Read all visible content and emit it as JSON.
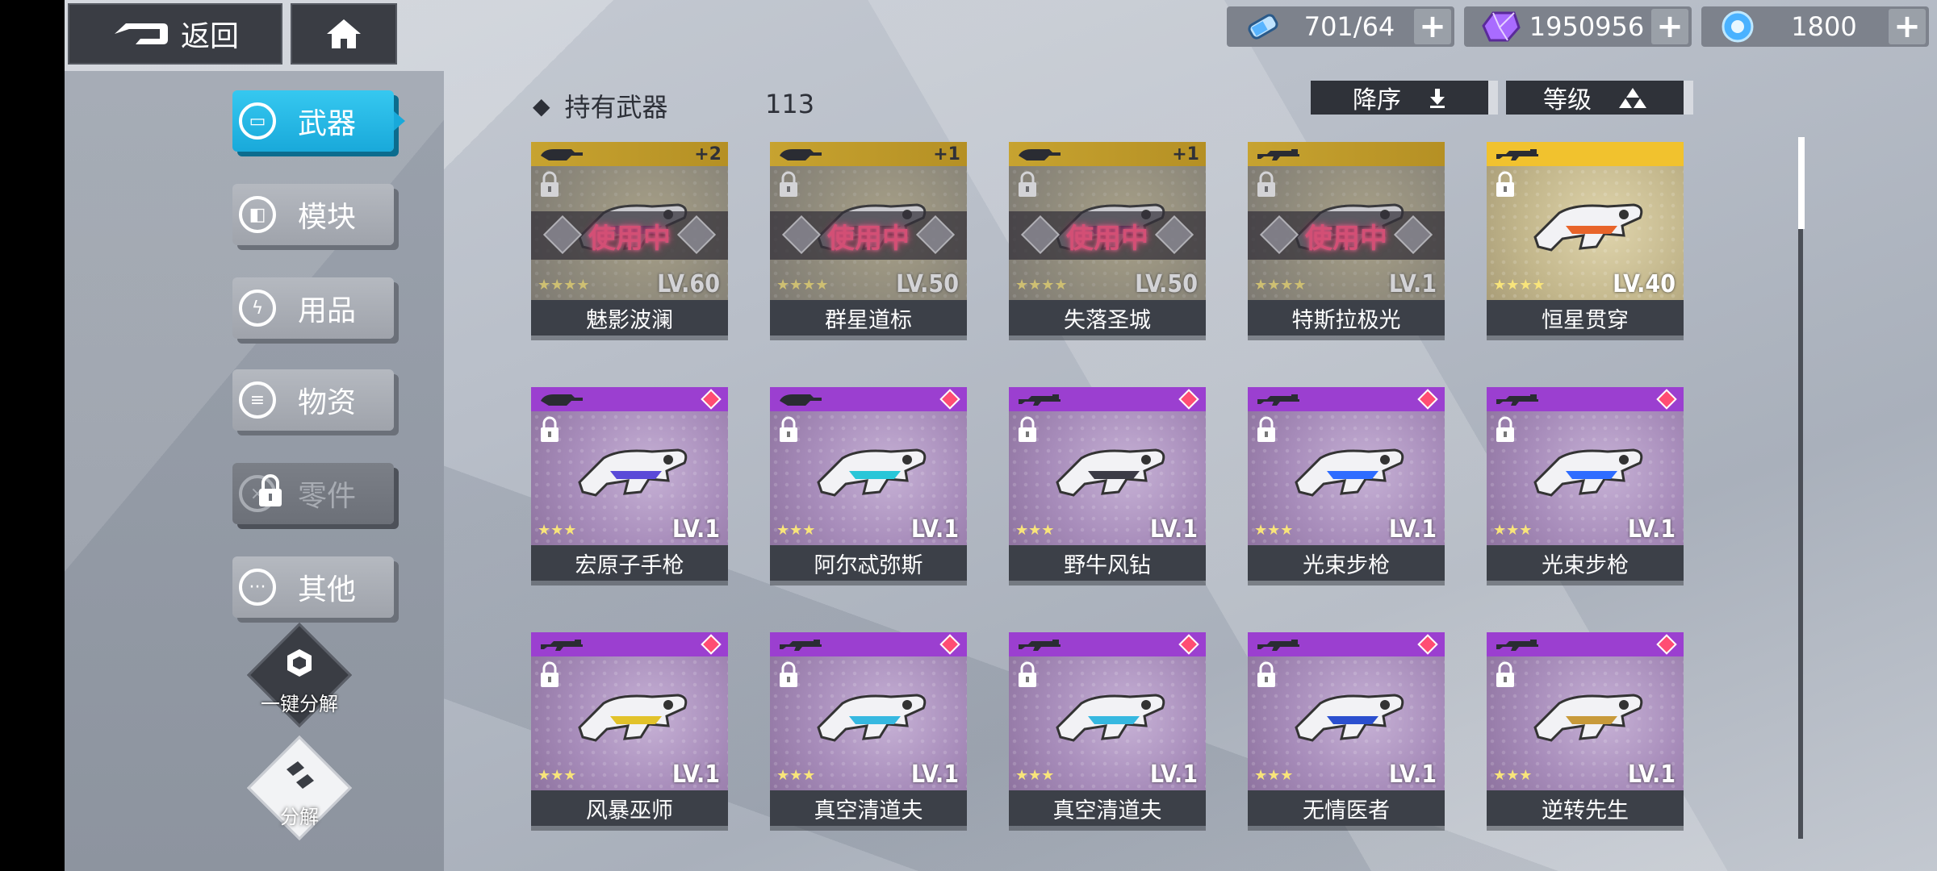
{
  "topbar": {
    "back_label": "返回",
    "resources": [
      {
        "icon": "energy-vial-icon",
        "value": "701/64"
      },
      {
        "icon": "purple-crystal-icon",
        "value": "1950956"
      },
      {
        "icon": "blue-orb-icon",
        "value": "1800"
      }
    ]
  },
  "sidebar": {
    "categories": [
      {
        "label": "武器",
        "icon": "gun-icon",
        "state": "active"
      },
      {
        "label": "模块",
        "icon": "module-icon",
        "state": "normal"
      },
      {
        "label": "用品",
        "icon": "lightning-icon",
        "state": "normal"
      },
      {
        "label": "物资",
        "icon": "supplies-icon",
        "state": "normal"
      },
      {
        "label": "零件",
        "icon": "parts-icon",
        "state": "locked"
      },
      {
        "label": "其他",
        "icon": "more-icon",
        "state": "normal"
      }
    ],
    "quick_dismantle_label": "一键分解",
    "dismantle_label": "分解"
  },
  "list": {
    "title": "持有武器",
    "count": "113",
    "sort_order_label": "降序",
    "sort_key_label": "等级"
  },
  "colors": {
    "accent": "#19a9da",
    "gold": "#f1c22e",
    "purple": "#9b3fd0",
    "in_use": "#ff4f7e"
  },
  "weapons": [
    {
      "name": "魅影波澜",
      "level": "LV.60",
      "stars": 4,
      "rarity": "gold",
      "plus": "+2",
      "in_use": true,
      "in_use_label": "使用中",
      "icon": "heavy-gun-icon"
    },
    {
      "name": "群星道标",
      "level": "LV.50",
      "stars": 4,
      "rarity": "gold",
      "plus": "+1",
      "in_use": true,
      "in_use_label": "使用中",
      "icon": "heavy-gun-icon"
    },
    {
      "name": "失落圣城",
      "level": "LV.50",
      "stars": 4,
      "rarity": "gold",
      "plus": "+1",
      "in_use": true,
      "in_use_label": "使用中",
      "icon": "heavy-gun-icon"
    },
    {
      "name": "特斯拉极光",
      "level": "LV.1",
      "stars": 4,
      "rarity": "gold",
      "plus": "",
      "in_use": true,
      "in_use_label": "使用中",
      "icon": "rifle-icon"
    },
    {
      "name": "恒星贯穿",
      "level": "LV.40",
      "stars": 4,
      "rarity": "gold-bright",
      "plus": "",
      "in_use": false,
      "icon": "rifle-icon"
    },
    {
      "name": "宏原子手枪",
      "level": "LV.1",
      "stars": 3,
      "rarity": "purple",
      "plus": "",
      "in_use": false,
      "icon": "heavy-gun-icon"
    },
    {
      "name": "阿尔忒弥斯",
      "level": "LV.1",
      "stars": 3,
      "rarity": "purple",
      "plus": "",
      "in_use": false,
      "icon": "heavy-gun-icon"
    },
    {
      "name": "野牛风钻",
      "level": "LV.1",
      "stars": 3,
      "rarity": "purple",
      "plus": "",
      "in_use": false,
      "icon": "rifle-icon"
    },
    {
      "name": "光束步枪",
      "level": "LV.1",
      "stars": 3,
      "rarity": "purple",
      "plus": "",
      "in_use": false,
      "icon": "rifle-icon"
    },
    {
      "name": "光束步枪",
      "level": "LV.1",
      "stars": 3,
      "rarity": "purple",
      "plus": "",
      "in_use": false,
      "icon": "rifle-icon"
    },
    {
      "name": "风暴巫师",
      "level": "LV.1",
      "stars": 3,
      "rarity": "purple",
      "plus": "",
      "in_use": false,
      "icon": "rifle-icon"
    },
    {
      "name": "真空清道夫",
      "level": "LV.1",
      "stars": 3,
      "rarity": "purple",
      "plus": "",
      "in_use": false,
      "icon": "rifle-icon"
    },
    {
      "name": "真空清道夫",
      "level": "LV.1",
      "stars": 3,
      "rarity": "purple",
      "plus": "",
      "in_use": false,
      "icon": "rifle-icon"
    },
    {
      "name": "无情医者",
      "level": "LV.1",
      "stars": 3,
      "rarity": "purple",
      "plus": "",
      "in_use": false,
      "icon": "rifle-icon"
    },
    {
      "name": "逆转先生",
      "level": "LV.1",
      "stars": 3,
      "rarity": "purple",
      "plus": "",
      "in_use": false,
      "icon": "rifle-icon"
    }
  ]
}
